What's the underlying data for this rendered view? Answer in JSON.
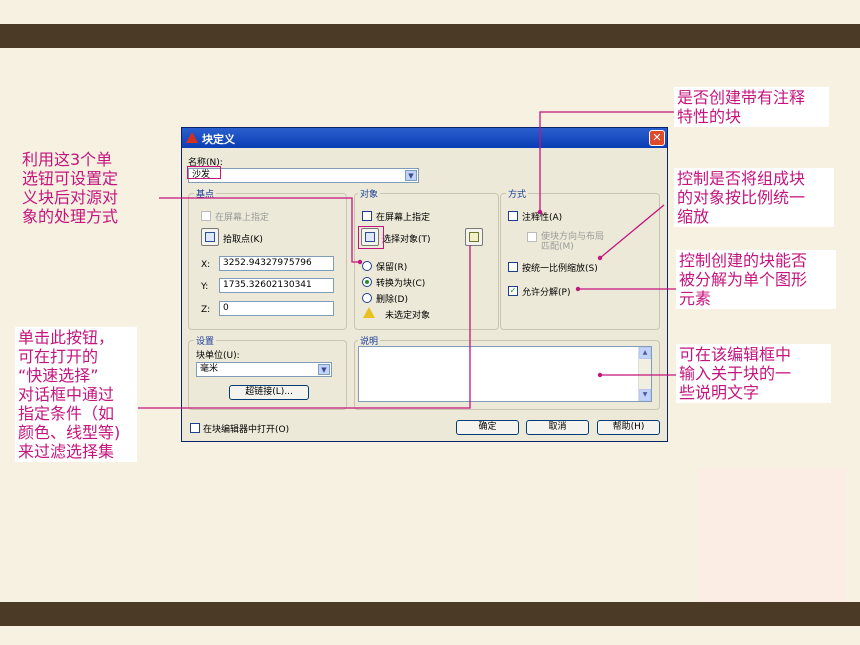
{
  "dialog": {
    "title": "块定义",
    "close_glyph": "✕",
    "name_label": "名称(N):",
    "name_value": "沙发",
    "basepoint": {
      "header": "基点",
      "specify_on_screen": "在屏幕上指定",
      "pick_point": "拾取点(K)",
      "x_label": "X:",
      "x_value": "3252.94327975796",
      "y_label": "Y:",
      "y_value": "1735.32602130341",
      "z_label": "Z:",
      "z_value": "0"
    },
    "objects": {
      "header": "对象",
      "specify_on_screen": "在屏幕上指定",
      "select_objects": "选择对象(T)",
      "retain": "保留(R)",
      "convert_to_block": "转换为块(C)",
      "delete": "删除(D)",
      "none_selected": "未选定对象"
    },
    "behavior": {
      "header": "方式",
      "annotative": "注释性(A)",
      "match_orientation_line1": "使块方向与布局",
      "match_orientation_line2": "匹配(M)",
      "scale_uniformly": "按统一比例缩放(S)",
      "allow_exploding": "允许分解(P)"
    },
    "settings": {
      "header": "设置",
      "block_unit_label": "块单位(U):",
      "block_unit_value": "毫米",
      "hyperlink": "超链接(L)..."
    },
    "description": {
      "header": "说明"
    },
    "open_in_editor": "在块编辑器中打开(O)",
    "ok": "确定",
    "cancel": "取消",
    "help": "帮助(H)"
  },
  "callouts": {
    "radio_note": [
      "利用这3个单",
      "选钮可设置定",
      "义块后对源对",
      "象的处理方式"
    ],
    "quickselect_note": [
      "单击此按钮，",
      "可在打开的",
      "“快速选择”",
      "对话框中通过",
      "指定条件（如",
      "颜色、线型等)",
      "来过滤选择集"
    ],
    "annotative_note": [
      "是否创建带有注释",
      "特性的块"
    ],
    "scale_note": [
      "控制是否将组成块",
      "的对象按比例统一",
      "缩放"
    ],
    "explode_note": [
      "控制创建的块能否",
      "被分解为单个图形",
      "元素"
    ],
    "desc_note": [
      "可在该编辑框中",
      "输入关于块的一",
      "些说明文字"
    ]
  },
  "colors": {
    "accent": "#c4157e",
    "bar": "#4b3a26",
    "background": "#f7f1e2"
  }
}
